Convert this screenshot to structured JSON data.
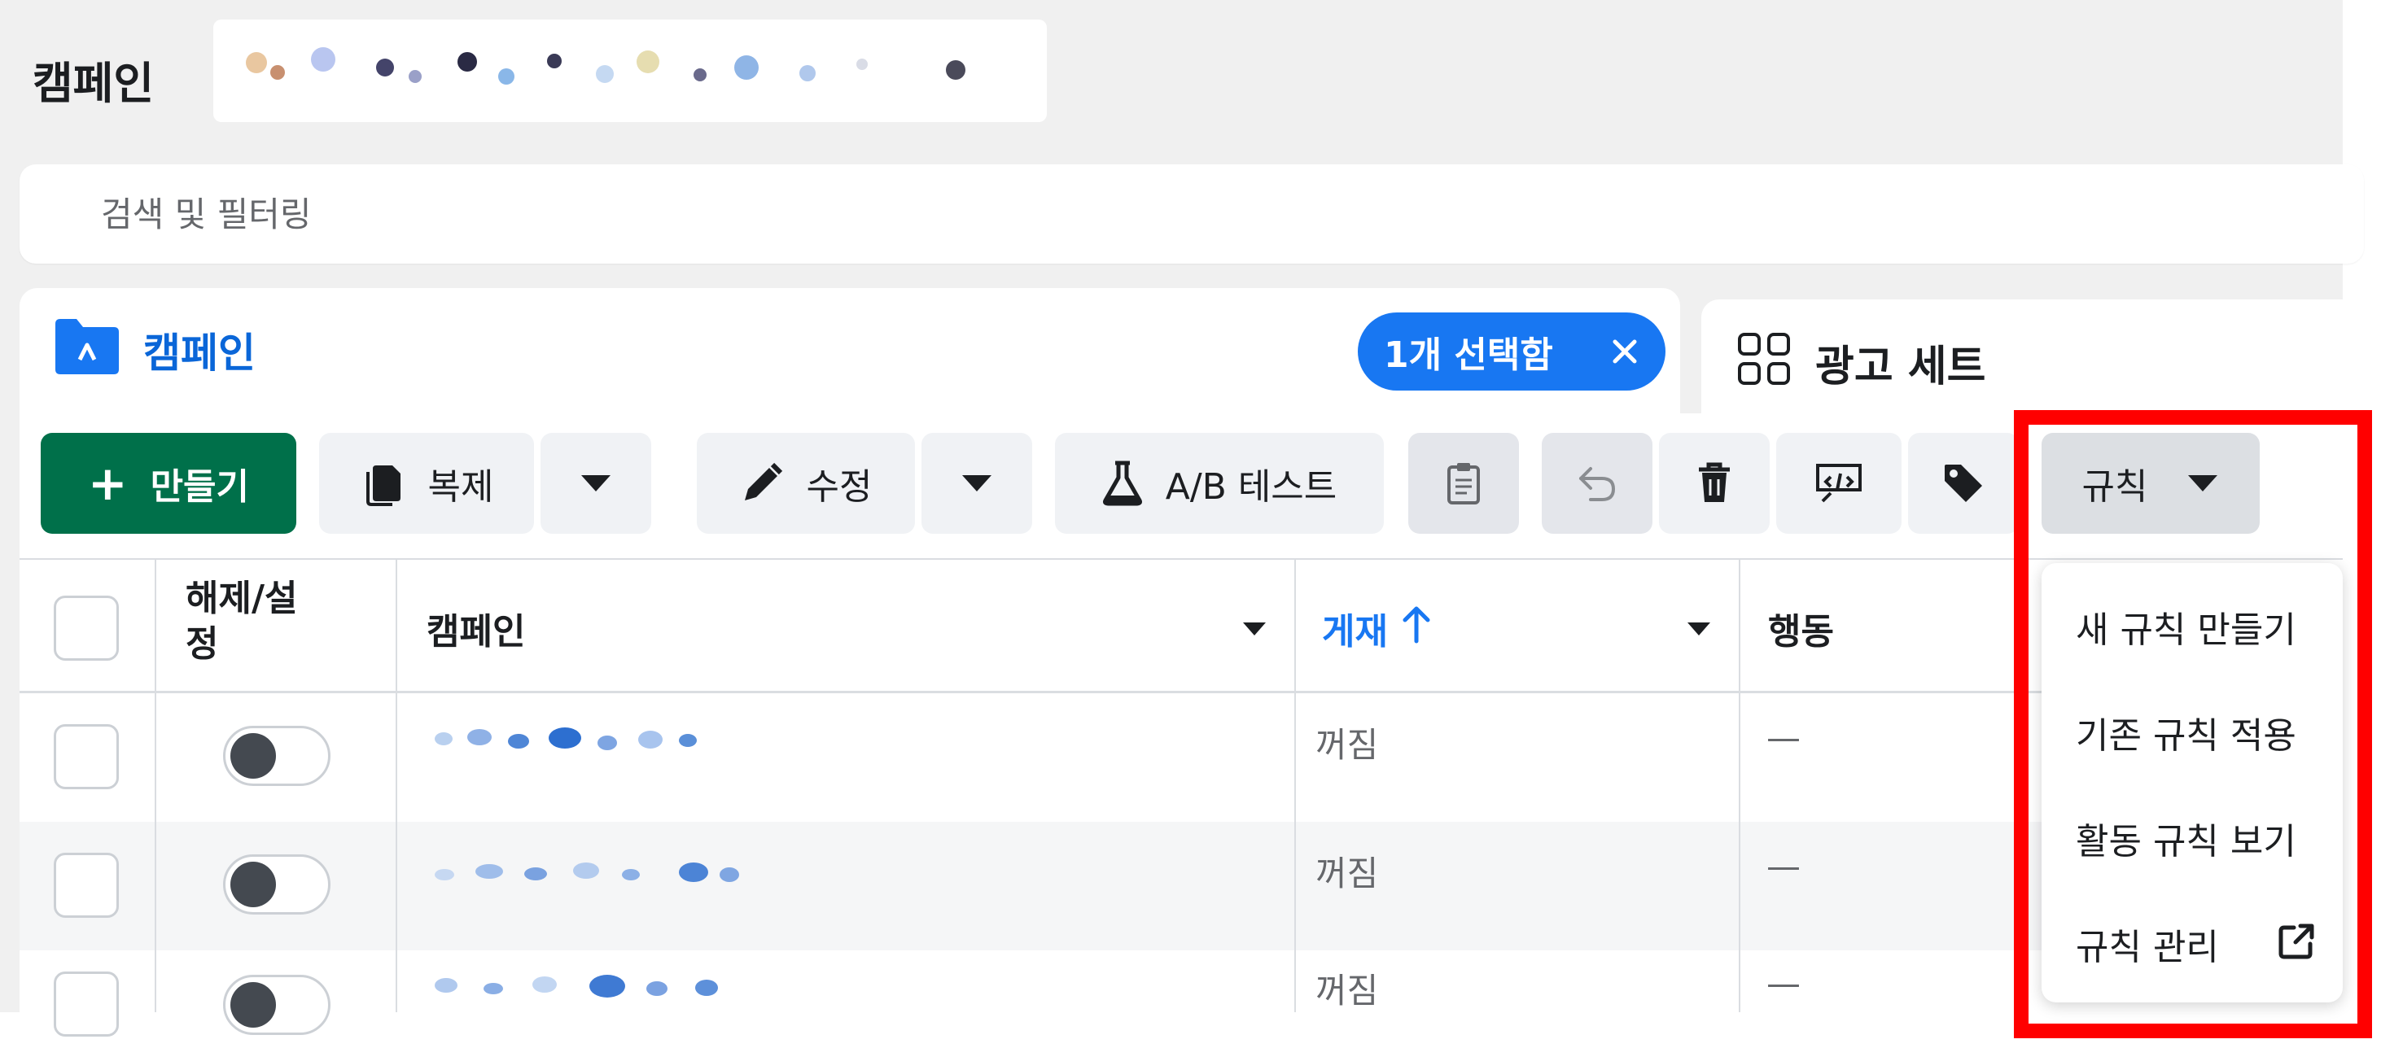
{
  "header": {
    "title": "캠페인"
  },
  "search": {
    "placeholder": "검색 및 필터링"
  },
  "tabs": {
    "campaign": {
      "label": "캠페인",
      "selected_text": "1개 선택함"
    },
    "adset": {
      "label": "광고 세트"
    }
  },
  "toolbar": {
    "create": "만들기",
    "duplicate": "복제",
    "edit": "수정",
    "abtest": "A/B 테스트",
    "rules": "규칙"
  },
  "table": {
    "columns": [
      "해제/설정",
      "캠페인",
      "게재",
      "행동"
    ],
    "rows": [
      {
        "delivery": "꺼짐",
        "action": "—"
      },
      {
        "delivery": "꺼짐",
        "action": "—"
      },
      {
        "delivery": "꺼짐",
        "action": "—"
      }
    ]
  },
  "rules_menu": {
    "items": [
      "새 규칙 만들기",
      "기존 규칙 적용",
      "활동 규칙 보기",
      "규칙 관리"
    ]
  },
  "colors": {
    "primary_blue": "#1877f2",
    "create_green": "#00704a",
    "highlight_red": "#ff0000"
  },
  "icons": [
    "folder-icon",
    "close-icon",
    "grid-icon",
    "plus-icon",
    "duplicate-icon",
    "chevron-down-icon",
    "pencil-icon",
    "flask-icon",
    "clipboard-icon",
    "undo-icon",
    "trash-icon",
    "preview-icon",
    "tag-icon",
    "sort-up-arrow-icon",
    "external-link-icon"
  ]
}
